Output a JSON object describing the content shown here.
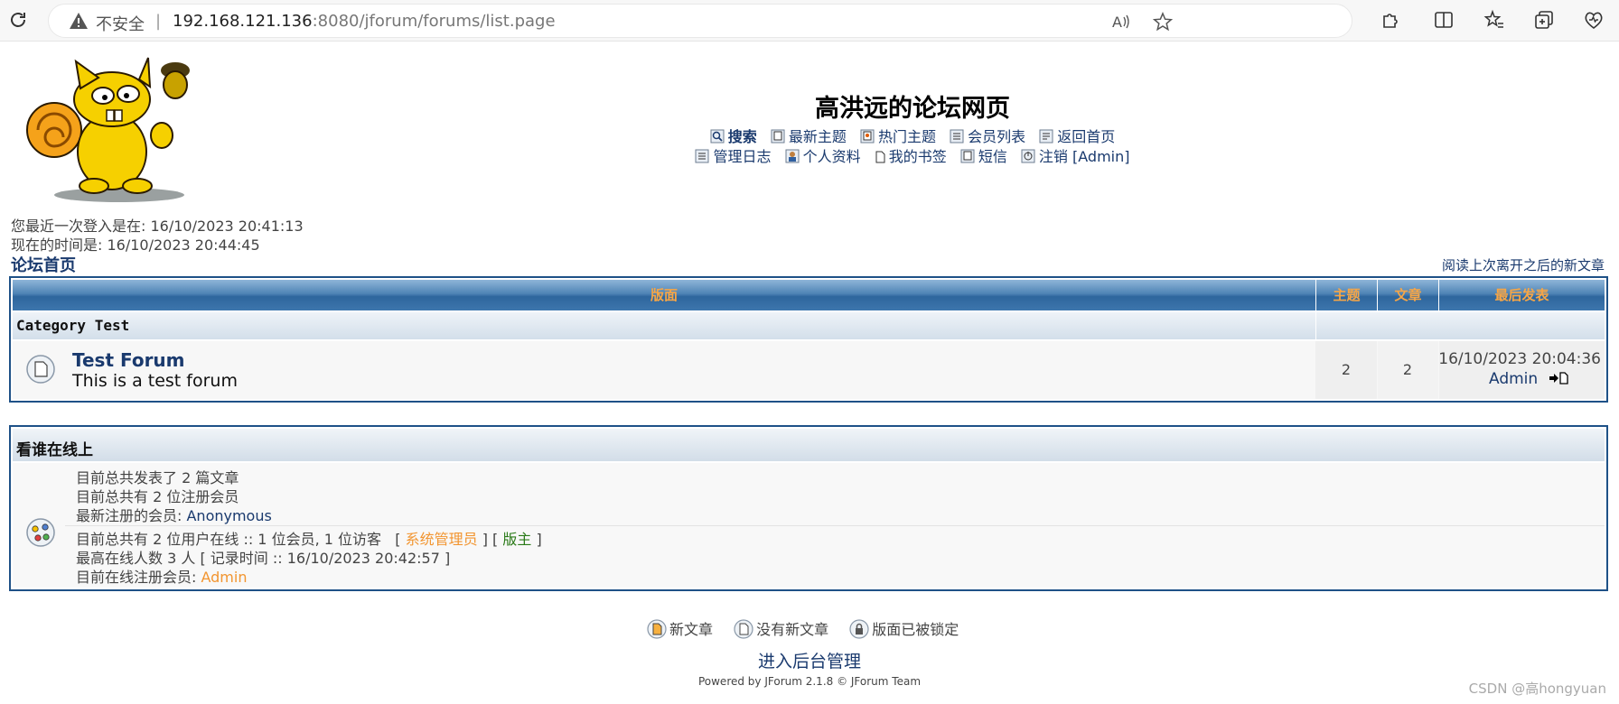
{
  "browser": {
    "security_label": "不安全",
    "separator": "|",
    "url_host": "192.168.121.136",
    "url_rest": ":8080/jforum/forums/list.page"
  },
  "header": {
    "site_title": "高洪远的论坛网页",
    "nav_row1": [
      {
        "label": "搜索",
        "icon": "search-icon"
      },
      {
        "label": "最新主题",
        "icon": "recent-topics-icon"
      },
      {
        "label": "热门主题",
        "icon": "hot-topics-icon"
      },
      {
        "label": "会员列表",
        "icon": "member-list-icon"
      },
      {
        "label": "返回首页",
        "icon": "home-icon"
      }
    ],
    "nav_row2": [
      {
        "label": "管理日志",
        "icon": "moderation-log-icon"
      },
      {
        "label": "个人资料",
        "icon": "profile-icon"
      },
      {
        "label": "我的书签",
        "icon": "bookmark-icon"
      },
      {
        "label": "短信",
        "icon": "private-message-icon"
      },
      {
        "label": "注销 [Admin]",
        "icon": "logout-icon"
      }
    ]
  },
  "session": {
    "last_login": "您最近一次登入是在: 16/10/2023 20:41:13",
    "current_time": "现在的时间是: 16/10/2023 20:44:45"
  },
  "breadcrumb": "论坛首页",
  "new_posts_link": "阅读上次离开之后的新文章",
  "forum_table": {
    "headers": {
      "forum": "版面",
      "topics": "主题",
      "posts": "文章",
      "last_post": "最后发表"
    },
    "category": "Category Test",
    "forums": [
      {
        "name": "Test Forum",
        "description": "This is a test forum",
        "topics": "2",
        "posts": "2",
        "last_post_date": "16/10/2023 20:04:36",
        "last_post_user": "Admin"
      }
    ]
  },
  "online": {
    "title": "看谁在线上",
    "total_posts": "目前总共发表了 2 篇文章",
    "total_users": "目前总共有 2 位注册会员",
    "newest_label": "最新注册的会员: ",
    "newest_user": "Anonymous",
    "online_prefix": "目前总共有 2 位用户在线 :: 1 位会员, 1 位访客   [ ",
    "role_admin": "系统管理员",
    "role_mid": " ] [ ",
    "role_mod": "版主",
    "role_end": " ]",
    "record": "最高在线人数 3 人 [ 记录时间 :: 16/10/2023 20:42:57 ]",
    "registered_label": "目前在线注册会员: ",
    "registered_user": "Admin"
  },
  "legend": {
    "new_posts": "新文章",
    "no_new_posts": "没有新文章",
    "locked": "版面已被锁定"
  },
  "footer": {
    "admin_link": "进入后台管理",
    "powered_by": "Powered by JForum 2.1.8 © JForum Team",
    "watermark": "CSDN @高hongyuan"
  },
  "colors": {
    "header_blue": "#1e5187",
    "link": "#1a3a6e",
    "header_text_orange": "#f7a646",
    "admin_orange": "#f29530",
    "moderator_green": "#2a7a18"
  }
}
